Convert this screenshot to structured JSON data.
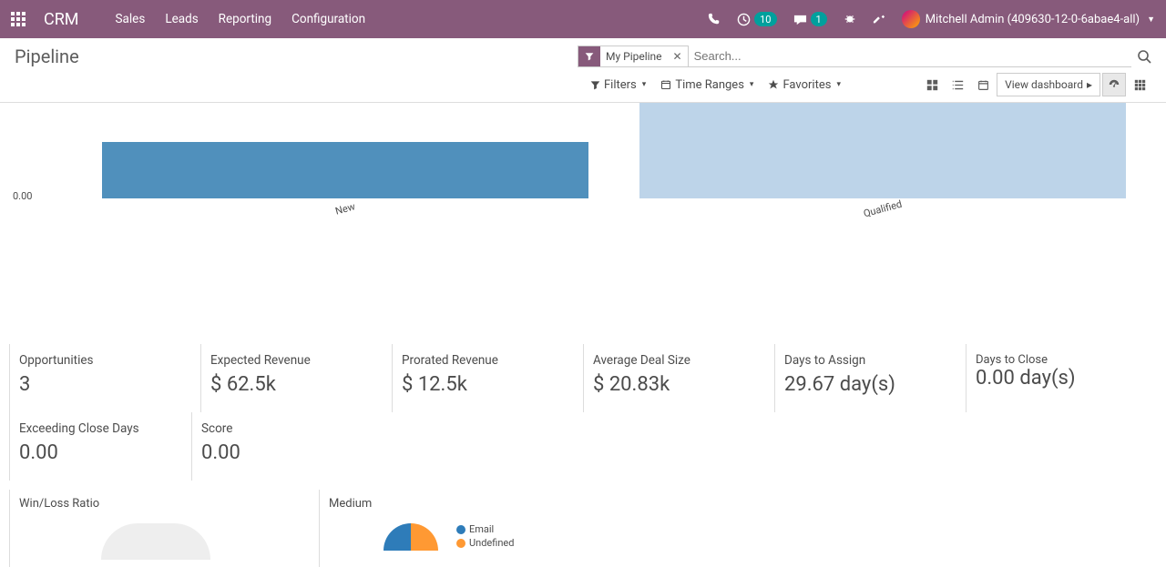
{
  "nav": {
    "brand": "CRM",
    "items": [
      "Sales",
      "Leads",
      "Reporting",
      "Configuration"
    ],
    "clock_badge": "10",
    "chat_badge": "1",
    "user_name": "Mitchell Admin (409630-12-0-6abae4-all)"
  },
  "cp": {
    "title": "Pipeline",
    "facet_label": "My Pipeline",
    "search_placeholder": "Search...",
    "filters_label": "Filters",
    "timeranges_label": "Time Ranges",
    "favorites_label": "Favorites",
    "view_dashboard_label": "View dashboard"
  },
  "chart_data": {
    "type": "bar",
    "categories": [
      "New",
      "Qualified"
    ],
    "values": [
      60,
      100
    ],
    "ytick": "0.00"
  },
  "kpis_row1": [
    {
      "label": "Opportunities",
      "value": "3"
    },
    {
      "label": "Expected Revenue",
      "value": "$ 62.5k"
    },
    {
      "label": "Prorated Revenue",
      "value": "$ 12.5k"
    },
    {
      "label": "Average Deal Size",
      "value": "$ 20.83k"
    },
    {
      "label": "Days to Assign",
      "value": "29.67 day(s)"
    },
    {
      "label": "Days to Close",
      "value": "0.00 day(s)"
    }
  ],
  "kpis_row2": [
    {
      "label": "Exceeding Close Days",
      "value": "0.00"
    },
    {
      "label": "Score",
      "value": "0.00"
    }
  ],
  "sub": {
    "winloss_title": "Win/Loss Ratio",
    "medium_title": "Medium",
    "legend": [
      {
        "label": "Email",
        "color": "#2e7cb9"
      },
      {
        "label": "Undefined",
        "color": "#ff9933"
      }
    ]
  }
}
